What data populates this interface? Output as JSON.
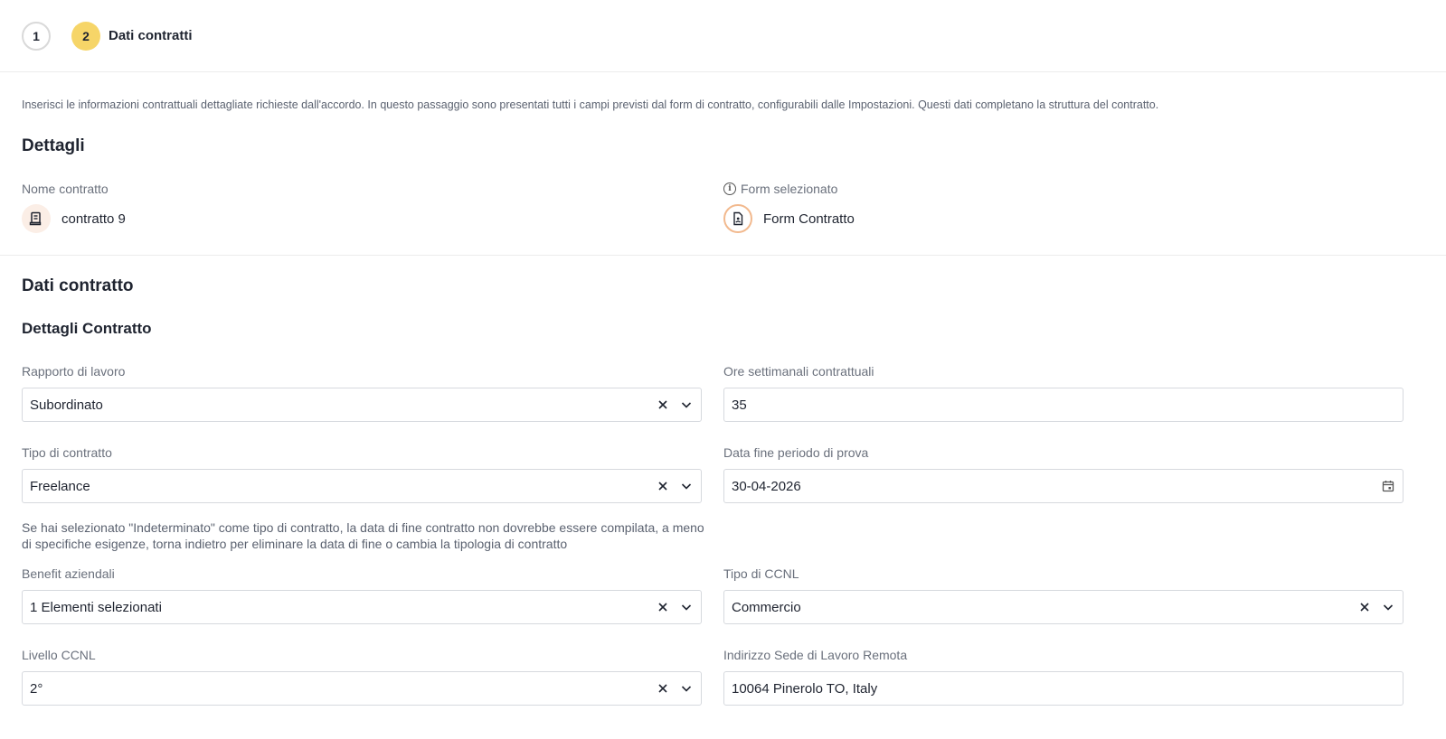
{
  "stepper": {
    "steps": [
      {
        "number": "1",
        "label": ""
      },
      {
        "number": "2",
        "label": "Dati contratti"
      }
    ]
  },
  "intro": "Inserisci le informazioni contrattuali dettagliate richieste dall'accordo. In questo passaggio sono presentati tutti i campi previsti dal form di contratto, configurabili dalle Impostazioni. Questi dati completano la struttura del contratto.",
  "details": {
    "title": "Dettagli",
    "contract_name_label": "Nome contratto",
    "contract_name_value": "contratto 9",
    "form_label": "Form selezionato",
    "form_value": "Form Contratto"
  },
  "contract_data": {
    "title": "Dati contratto",
    "subtitle": "Dettagli Contratto",
    "fields": {
      "rapporto": {
        "label": "Rapporto di lavoro",
        "value": "Subordinato"
      },
      "ore": {
        "label": "Ore settimanali contrattuali",
        "value": "35"
      },
      "tipo_contratto": {
        "label": "Tipo di contratto",
        "value": "Freelance"
      },
      "data_fine_prova": {
        "label": "Data fine periodo di prova",
        "value": "30-04-2026"
      },
      "benefit": {
        "label": "Benefit aziendali",
        "value": "1 Elementi selezionati"
      },
      "tipo_ccnl": {
        "label": "Tipo di CCNL",
        "value": "Commercio"
      },
      "livello_ccnl": {
        "label": "Livello CCNL",
        "value": "2°"
      },
      "indirizzo": {
        "label": "Indirizzo Sede di Lavoro Remota",
        "value": "10064 Pinerolo TO, Italy"
      }
    },
    "contract_type_hint": "Se hai selezionato \"Indeterminato\" come tipo di contratto, la data di fine contratto non dovrebbe essere compilata, a meno di specifiche esigenze, torna indietro per eliminare la data di fine o cambia la tipologia di contratto"
  },
  "icons": {
    "contract": "contract-icon",
    "form": "form-document-icon",
    "info": "info-icon",
    "clear": "close-icon",
    "dropdown": "chevron-down-icon",
    "calendar": "calendar-icon"
  },
  "colors": {
    "active_step": "#f6d568",
    "form_ring": "#f2b98e"
  }
}
